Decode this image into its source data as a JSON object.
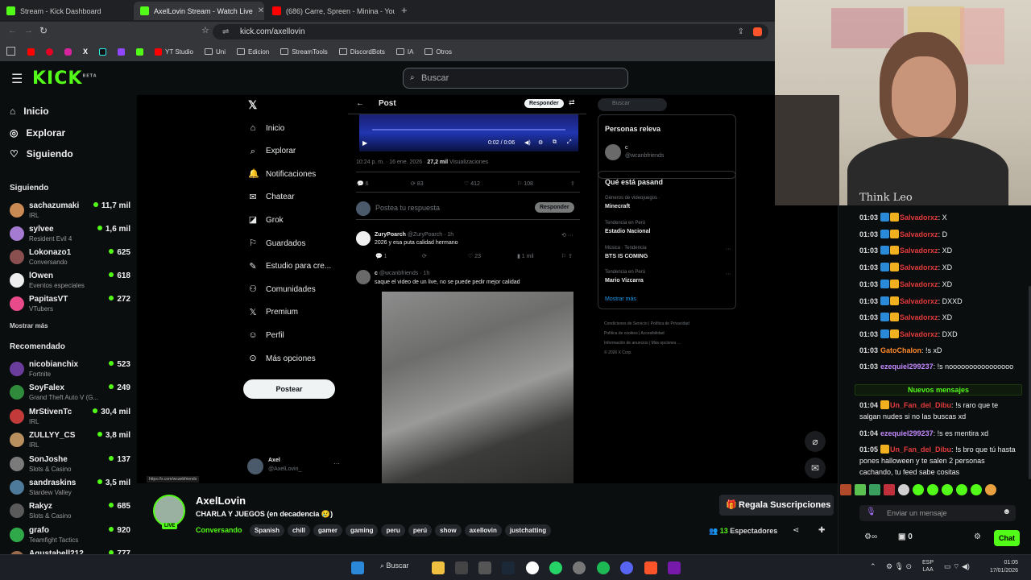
{
  "browser": {
    "tabs": [
      {
        "title": "Stream - Kick Dashboard",
        "favicon_color": "#53fc18"
      },
      {
        "title": "AxelLovin Stream - Watch Live",
        "favicon_color": "#53fc18"
      },
      {
        "title": "(686) Carre, Spreen - Minina - YouTube",
        "favicon_color": "#ff0000"
      }
    ],
    "new_tab": "+",
    "url": "kick.com/axellovin",
    "bookmarks": [
      "YT Studio",
      "Uni",
      "Edicion",
      "StreamTools",
      "DiscordBots",
      "IA",
      "Otros"
    ]
  },
  "kick": {
    "logo": "KICK",
    "logo_sup": "BETA",
    "search_placeholder": "Buscar",
    "nav": [
      {
        "label": "Inicio",
        "icon": "home-icon"
      },
      {
        "label": "Explorar",
        "icon": "compass-icon"
      },
      {
        "label": "Siguiendo",
        "icon": "heart-icon"
      }
    ],
    "following_title": "Siguiendo",
    "following": [
      {
        "name": "sachazumaki",
        "sub": "IRL",
        "count": "11,7 mil",
        "color": "#c98b53"
      },
      {
        "name": "sylvee",
        "sub": "Resident Evil 4",
        "count": "1,6 mil",
        "color": "#a57bd1"
      },
      {
        "name": "Lokonazo1",
        "sub": "Conversando",
        "count": "625",
        "color": "#8a4f4f"
      },
      {
        "name": "lOwen",
        "sub": "Eventos especiales",
        "count": "618",
        "color": "#eeeeee"
      },
      {
        "name": "PapitasVT",
        "sub": "VTubers",
        "count": "272",
        "color": "#e84a8a"
      }
    ],
    "show_more": "Mostrar más",
    "recommended_title": "Recomendado",
    "recommended": [
      {
        "name": "nicobianchix",
        "sub": "Fortnite",
        "count": "523",
        "color": "#6a3c9c"
      },
      {
        "name": "SoyFalex",
        "sub": "Grand Theft Auto V (G...",
        "count": "249",
        "color": "#2f8a3c"
      },
      {
        "name": "MrStivenTc",
        "sub": "IRL",
        "count": "30,4 mil",
        "color": "#c23a3a"
      },
      {
        "name": "ZULLYY_CS",
        "sub": "IRL",
        "count": "3,8 mil",
        "color": "#b89060"
      },
      {
        "name": "SonJoshe",
        "sub": "Slots & Casino",
        "count": "137",
        "color": "#7a7a7a"
      },
      {
        "name": "sandraskins",
        "sub": "Stardew Valley",
        "count": "3,5 mil",
        "color": "#4d7a9a"
      },
      {
        "name": "Rakyz",
        "sub": "Slots & Casino",
        "count": "685",
        "color": "#5a5a5a"
      },
      {
        "name": "grafo",
        "sub": "Teamfight Tactics",
        "count": "920",
        "color": "#2fa84a"
      },
      {
        "name": "Agustabell212",
        "sub": "",
        "count": "777",
        "color": "#9a6a4a"
      }
    ]
  },
  "x_page": {
    "nav": [
      {
        "label": "Inicio",
        "icon": "home-icon"
      },
      {
        "label": "Explorar",
        "icon": "search-icon"
      },
      {
        "label": "Notificaciones",
        "icon": "bell-icon"
      },
      {
        "label": "Chatear",
        "icon": "mail-icon"
      },
      {
        "label": "Grok",
        "icon": "grok-icon"
      },
      {
        "label": "Guardados",
        "icon": "bookmark-icon"
      },
      {
        "label": "Estudio para cre...",
        "icon": "studio-icon"
      },
      {
        "label": "Comunidades",
        "icon": "people-icon"
      },
      {
        "label": "Premium",
        "icon": "x-icon"
      },
      {
        "label": "Perfil",
        "icon": "person-icon"
      },
      {
        "label": "Más opciones",
        "icon": "more-icon"
      }
    ],
    "post_button": "Postear",
    "account_name": "Axel",
    "account_handle": "@AxelLovin_",
    "status_url": "https://x.com/wcanbfriends",
    "header_title": "Post",
    "header_reply": "Responder",
    "video_time": "0:02 / 0:06",
    "meta_text": "10:24 p. m. · 16 ene. 2026 ·",
    "meta_views": "27,2 mil",
    "meta_views_label": "Visualizaciones",
    "stats": [
      "6",
      "83",
      "412",
      "108"
    ],
    "reply_placeholder": "Postea tu respuesta",
    "reply_button": "Responder",
    "comments": [
      {
        "name": "ZuryPoarch",
        "handle": "@ZuryPoarch · 1h",
        "text": "2026 y esa puta calidad hermano",
        "stats": [
          "1",
          "",
          "23",
          "1 mil"
        ]
      },
      {
        "name": "c",
        "handle": "@wcanbfriends · 1h",
        "text": "saque el video de un live, no se puede pedir mejor calidad"
      }
    ],
    "right": {
      "search": "Buscar",
      "relevant_title": "Personas releva",
      "relevant_user": "c",
      "relevant_handle": "@wcanbfriends",
      "happening_title": "Qué está pasand",
      "trends": [
        {
          "cat": "Géneros de videojuegos ·",
          "name": "Minecraft"
        },
        {
          "cat": "Tendencia en Perú",
          "name": "Estadio Nacional"
        },
        {
          "cat": "Música · Tendencia",
          "name": "BTS IS COMING"
        },
        {
          "cat": "Tendencia en Perú",
          "name": "Mario Vizcarra"
        }
      ],
      "show_more": "Mostrar más",
      "footer": [
        "Condiciones de Servicio",
        "Política de Privacidad",
        "Política de cookies",
        "Accesibilidad",
        "Información de anuncios",
        "Más opciones ...",
        "© 2026 X Corp."
      ]
    }
  },
  "stream": {
    "name": "AxelLovin",
    "live": "LIVE",
    "title": "CHARLA Y JUEGOS (en decadencia 😢)",
    "category": "Conversando",
    "tags": [
      "Spanish",
      "chill",
      "gamer",
      "gaming",
      "peru",
      "perú",
      "show",
      "axellovin",
      "justchatting"
    ],
    "gift_button": "Regala Suscripciones",
    "viewers": "13",
    "viewers_label": "Espectadores"
  },
  "chat": {
    "messages": [
      {
        "time": "01:03",
        "user": "Salvadorxz",
        "text": "X",
        "color": "#e23b3b"
      },
      {
        "time": "01:03",
        "user": "Salvadorxz",
        "text": "D",
        "color": "#e23b3b"
      },
      {
        "time": "01:03",
        "user": "Salvadorxz",
        "text": "XD",
        "color": "#e23b3b"
      },
      {
        "time": "01:03",
        "user": "Salvadorxz",
        "text": "XD",
        "color": "#e23b3b"
      },
      {
        "time": "01:03",
        "user": "Salvadorxz",
        "text": "XD",
        "color": "#e23b3b"
      },
      {
        "time": "01:03",
        "user": "Salvadorxz",
        "text": "DXXD",
        "color": "#e23b3b"
      },
      {
        "time": "01:03",
        "user": "Salvadorxz",
        "text": "XD",
        "color": "#e23b3b"
      },
      {
        "time": "01:03",
        "user": "Salvadorxz",
        "text": "DXD",
        "color": "#e23b3b"
      },
      {
        "time": "01:03",
        "user": "GatoChalon",
        "text": "!s xD",
        "color": "#ff8a2a"
      },
      {
        "time": "01:03",
        "user": "ezequiel299237",
        "text": "!s noooooooooooooooo",
        "color": "#c48bff"
      }
    ],
    "new_messages": "Nuevos mensajes",
    "messages2": [
      {
        "time": "01:04",
        "user": "Un_Fan_del_Dibu",
        "line1": "!s raro que te",
        "line2": "salgan nudes si no las buscas xd",
        "color": "#e23b3b"
      },
      {
        "time": "01:04",
        "user": "ezequiel299237",
        "line1": "!s es mentira xd",
        "color": "#c48bff"
      },
      {
        "time": "01:05",
        "user": "Un_Fan_del_Dibu",
        "line1": "!s bro que tú hasta",
        "line2": "pones halloween y te salen 2 personas",
        "line3": "cachando, tu feed sabe cositas",
        "color": "#e23b3b"
      }
    ],
    "input_placeholder": "Enviar un mensaje",
    "points": "0",
    "chat_button": "Chat"
  },
  "webcam": {
    "text": "Think Leo"
  },
  "taskbar": {
    "search": "Buscar",
    "lang": "ESP",
    "lang2": "LAA",
    "time": "01:05",
    "date": "17/01/2026"
  }
}
